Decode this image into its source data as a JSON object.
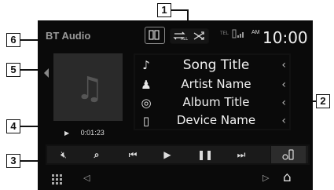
{
  "callouts": {
    "c1": "1",
    "c2": "2",
    "c3": "3",
    "c4": "4",
    "c5": "5",
    "c6": "6"
  },
  "header": {
    "source": "BT Audio",
    "clock_ampm": "AM",
    "clock_time": "10:00",
    "tel_label": "TEL"
  },
  "track": {
    "song_title": "Song Title",
    "artist_name": "Artist Name",
    "album_title": "Album Title",
    "device_name": "Device Name"
  },
  "playback": {
    "elapsed": "0:01:23"
  },
  "icons": {
    "play_mode": "repeat-all-icon",
    "shuffle": "shuffle-icon",
    "mute": "speaker-mute-icon",
    "search": "search-icon",
    "prev": "previous-track-icon",
    "play": "play-icon",
    "pause": "pause-icon",
    "next": "next-track-icon",
    "device_setup": "phone-settings-icon",
    "music_note": "music-note-icon",
    "artist": "artist-icon",
    "album": "album-icon",
    "device": "device-icon",
    "apps": "apps-grid-icon",
    "back": "back-triangle-icon",
    "home": "home-icon"
  },
  "colors": {
    "screen_bg": "#0a0a0a",
    "text": "#f2f2f2"
  }
}
